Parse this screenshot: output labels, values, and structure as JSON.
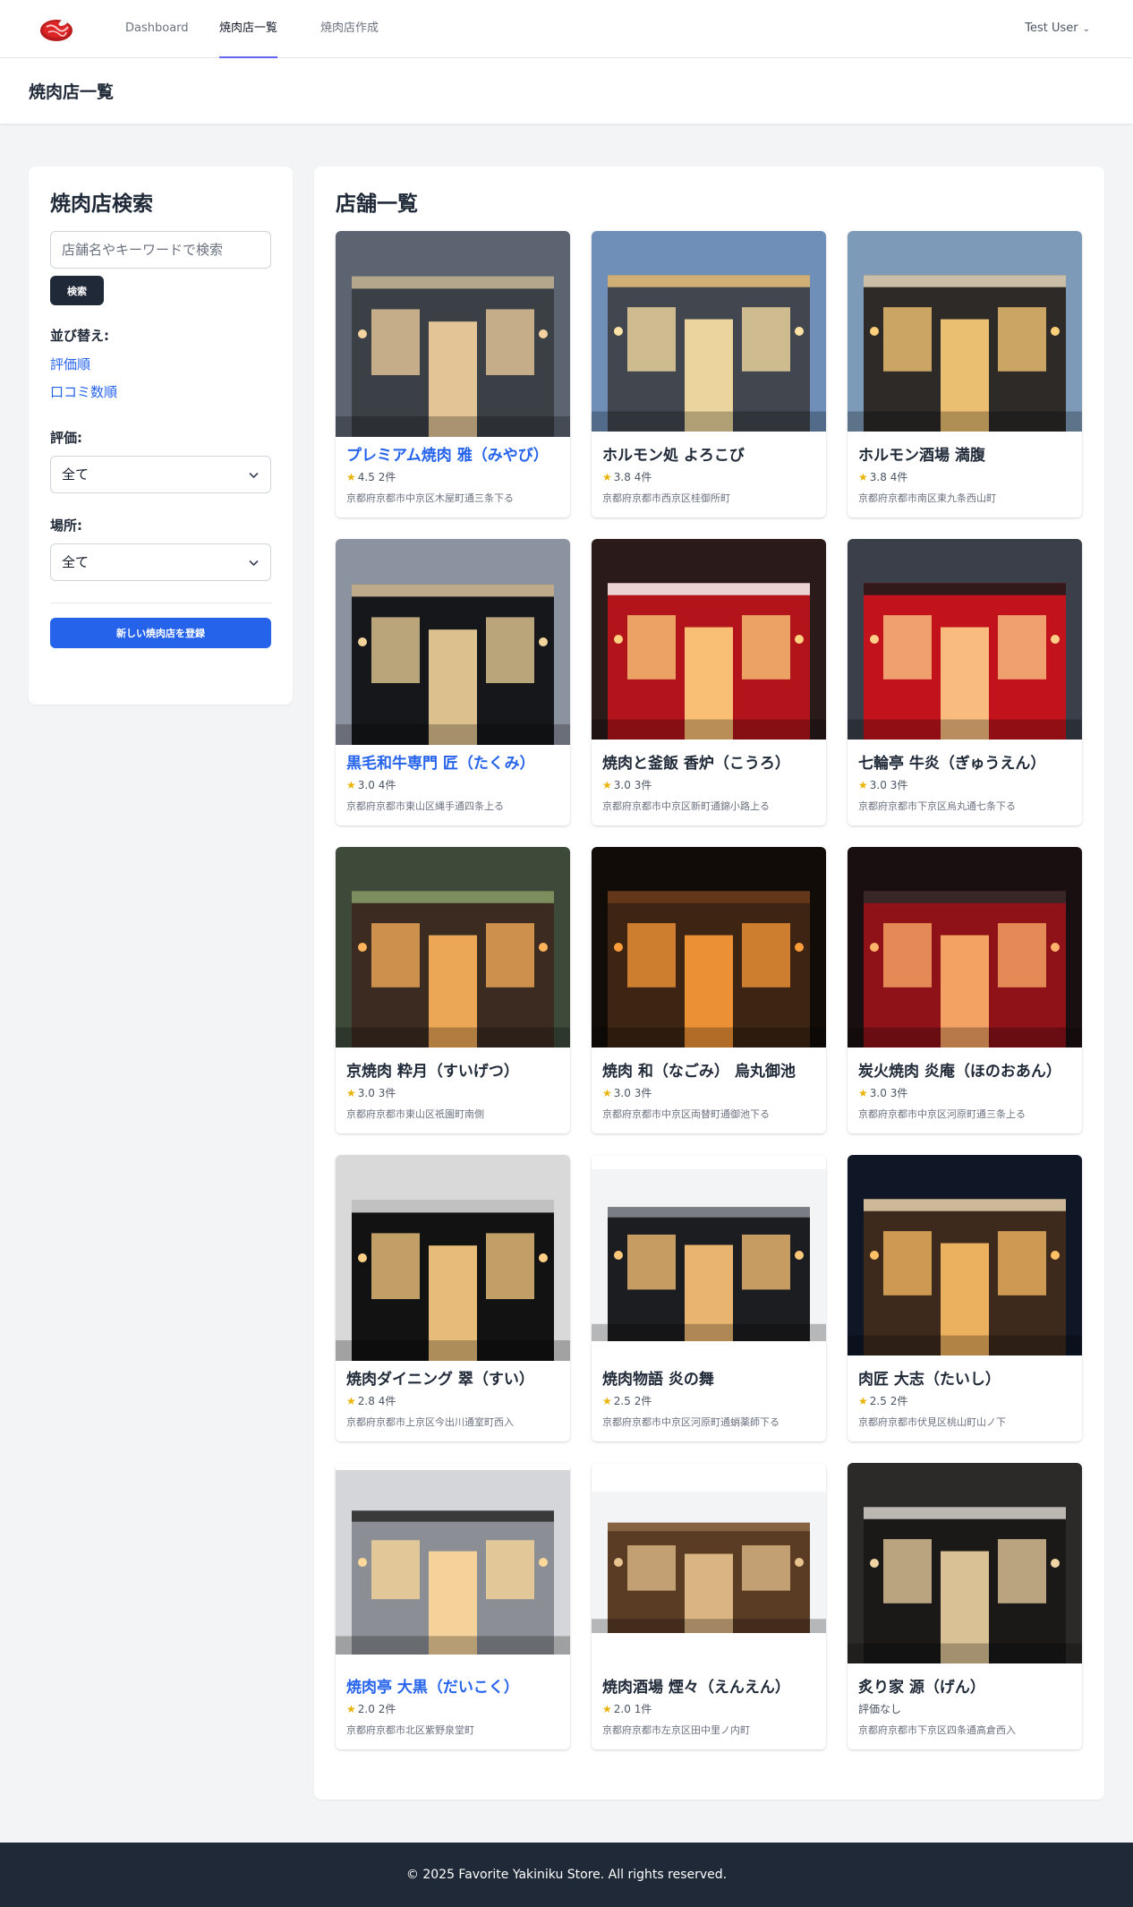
{
  "nav": {
    "links": [
      "Dashboard",
      "焼肉店一覧",
      "焼肉店作成"
    ],
    "user": "Test User"
  },
  "page_header": {
    "title": "焼肉店一覧"
  },
  "sidebar": {
    "title": "焼肉店検索",
    "search": {
      "placeholder": "店舗名やキーワードで検索",
      "value": ""
    },
    "search_button": "検索",
    "sort_label": "並び替え:",
    "sort_options": [
      "評価順",
      "口コミ数順"
    ],
    "rating_label": "評価:",
    "rating_value": "全て",
    "location_label": "場所:",
    "location_value": "全て",
    "register_button": "新しい焼肉店を登録"
  },
  "main": {
    "title": "店舗一覧",
    "shops": [
      {
        "name": "プレミアム焼肉 雅（みやび）",
        "rating": "4.5",
        "reviews": "2件",
        "address": "京都府京都市中京区木屋町通三条下る",
        "highlight": true,
        "rating_shown": true,
        "scene": "dining"
      },
      {
        "name": "ホルモン処 よろこび",
        "rating": "3.8",
        "reviews": "4件",
        "address": "京都府京都市西京区桂御所町",
        "highlight": false,
        "rating_shown": true,
        "scene": "modern-facade"
      },
      {
        "name": "ホルモン酒場 満腹",
        "rating": "3.8",
        "reviews": "4件",
        "address": "京都府京都市南区東九条西山町",
        "highlight": false,
        "rating_shown": true,
        "scene": "japanese-house"
      },
      {
        "name": "黒毛和牛専門 匠（たくみ）",
        "rating": "3.0",
        "reviews": "4件",
        "address": "京都府京都市東山区縄手通四条上る",
        "highlight": true,
        "rating_shown": true,
        "scene": "black-facade"
      },
      {
        "name": "焼肉と釜飯 香炉（こうろ）",
        "rating": "3.0",
        "reviews": "3件",
        "address": "京都府京都市中京区新町通錦小路上る",
        "highlight": false,
        "rating_shown": true,
        "scene": "red-street"
      },
      {
        "name": "七輪亭 牛炎（ぎゅうえん）",
        "rating": "3.0",
        "reviews": "3件",
        "address": "京都府京都市下京区烏丸通七条下る",
        "highlight": false,
        "rating_shown": true,
        "scene": "red-storefront"
      },
      {
        "name": "京焼肉 粋月（すいげつ）",
        "rating": "3.0",
        "reviews": "3件",
        "address": "京都府京都市東山区祇園町南側",
        "highlight": false,
        "rating_shown": true,
        "scene": "garden-house"
      },
      {
        "name": "焼肉 和（なごみ） 烏丸御池",
        "rating": "3.0",
        "reviews": "3件",
        "address": "京都府京都市中京区両替町通御池下る",
        "highlight": false,
        "rating_shown": true,
        "scene": "night-wood"
      },
      {
        "name": "炭火焼肉 炎庵（ほのおあん）",
        "rating": "3.0",
        "reviews": "3件",
        "address": "京都府京都市中京区河原町通三条上る",
        "highlight": false,
        "rating_shown": true,
        "scene": "red-interior"
      },
      {
        "name": "焼肉ダイニング 翠（すい）",
        "rating": "2.8",
        "reviews": "4件",
        "address": "京都府京都市上京区今出川通室町西入",
        "highlight": false,
        "rating_shown": true,
        "scene": "black-building"
      },
      {
        "name": "焼肉物語 炎の舞",
        "rating": "2.5",
        "reviews": "2件",
        "address": "京都府京都市中京区河原町通蛸薬師下る",
        "highlight": false,
        "rating_shown": true,
        "scene": "dark-cafe"
      },
      {
        "name": "肉匠 大志（たいし）",
        "rating": "2.5",
        "reviews": "2件",
        "address": "京都府京都市伏見区桃山町山ノ下",
        "highlight": false,
        "rating_shown": true,
        "scene": "lantern-house"
      },
      {
        "name": "焼肉亭 大黒（だいこく）",
        "rating": "2.0",
        "reviews": "2件",
        "address": "京都府京都市北区紫野泉堂町",
        "highlight": true,
        "rating_shown": true,
        "scene": "grey-shop"
      },
      {
        "name": "焼肉酒場 煙々（えんえん）",
        "rating": "2.0",
        "reviews": "1件",
        "address": "京都府京都市左京区田中里ノ内町",
        "highlight": false,
        "rating_shown": true,
        "scene": "wood-alley"
      },
      {
        "name": "炙り家 源（げん）",
        "rating": "",
        "reviews": "",
        "no_rating": "評価なし",
        "address": "京都府京都市下京区四条通高倉西入",
        "highlight": false,
        "rating_shown": false,
        "scene": "dark-dining"
      }
    ]
  },
  "footer": {
    "text": "© 2025 Favorite Yakiniku Store. All rights reserved."
  }
}
